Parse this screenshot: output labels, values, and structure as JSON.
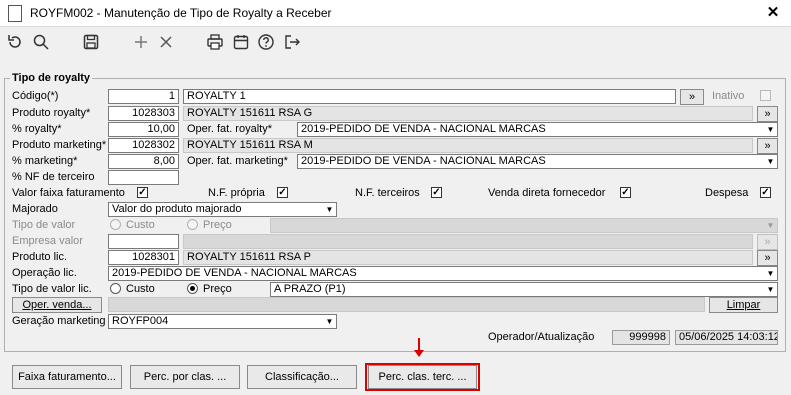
{
  "window": {
    "title": "ROYFM002 - Manutenção de Tipo de Royalty a Receber",
    "close_label": "✕"
  },
  "toolbar": {
    "icons": [
      "undo-icon",
      "search-icon",
      "save-icon",
      "add-icon",
      "delete-icon",
      "print-icon",
      "calendar-icon",
      "help-icon",
      "exit-icon"
    ]
  },
  "group": {
    "title": "Tipo de royalty"
  },
  "codigo": {
    "label": "Código(*)",
    "value": "1",
    "description": "ROYALTY 1",
    "btn": "»",
    "inativo_label": "Inativo"
  },
  "produto_royalty": {
    "label": "Produto royalty*",
    "value": "1028303",
    "description": "ROYALTY 151611 RSA G",
    "btn": "»"
  },
  "pct_royalty": {
    "label": "% royalty*",
    "value": "10,00",
    "oper_label": "Oper. fat. royalty*",
    "oper_value": "2019-PEDIDO DE VENDA - NACIONAL MARCAS"
  },
  "produto_marketing": {
    "label": "Produto marketing*",
    "value": "1028302",
    "description": "ROYALTY 151611 RSA M",
    "btn": "»"
  },
  "pct_marketing": {
    "label": "% marketing*",
    "value": "8,00",
    "oper_label": "Oper. fat. marketing*",
    "oper_value": "2019-PEDIDO DE VENDA - NACIONAL MARCAS"
  },
  "pct_nf": {
    "label": "% NF de terceiro",
    "value": ""
  },
  "checks": {
    "valor_faixa": {
      "label": "Valor faixa faturamento",
      "checked": true
    },
    "nf_propria": {
      "label": "N.F. própria",
      "checked": true
    },
    "nf_terceiros": {
      "label": "N.F. terceiros",
      "checked": true
    },
    "venda_direta": {
      "label": "Venda direta fornecedor",
      "checked": true
    },
    "despesa": {
      "label": "Despesa",
      "checked": true
    }
  },
  "majorado": {
    "label": "Majorado",
    "value": "Valor do produto majorado"
  },
  "tipo_valor": {
    "label": "Tipo de valor",
    "custo": "Custo",
    "preco": "Preço"
  },
  "empresa_valor": {
    "label": "Empresa valor",
    "btn": "»"
  },
  "produto_lic": {
    "label": "Produto lic.",
    "value": "1028301",
    "description": "ROYALTY 151611 RSA P",
    "btn": "»"
  },
  "operacao_lic": {
    "label": "Operação lic.",
    "value": "2019-PEDIDO DE VENDA - NACIONAL MARCAS"
  },
  "tipo_valor_lic": {
    "label": "Tipo de valor lic.",
    "custo": "Custo",
    "preco": "Preço",
    "condicao": "A PRAZO (P1)"
  },
  "oper_venda": {
    "btn": "Oper. venda...",
    "limpar": "Limpar"
  },
  "geracao_marketing": {
    "label": "Geração marketing",
    "value": "ROYFP004"
  },
  "operador": {
    "label": "Operador/Atualização",
    "id": "999998",
    "datetime": "05/06/2025 14:03:12"
  },
  "buttons": {
    "faixa": "Faixa faturamento...",
    "perc_clas": "Perc. por clas. ...",
    "classificacao": "Classificação...",
    "perc_terc": "Perc. clas. terc. ..."
  },
  "colors": {
    "highlight": "#d00000"
  }
}
